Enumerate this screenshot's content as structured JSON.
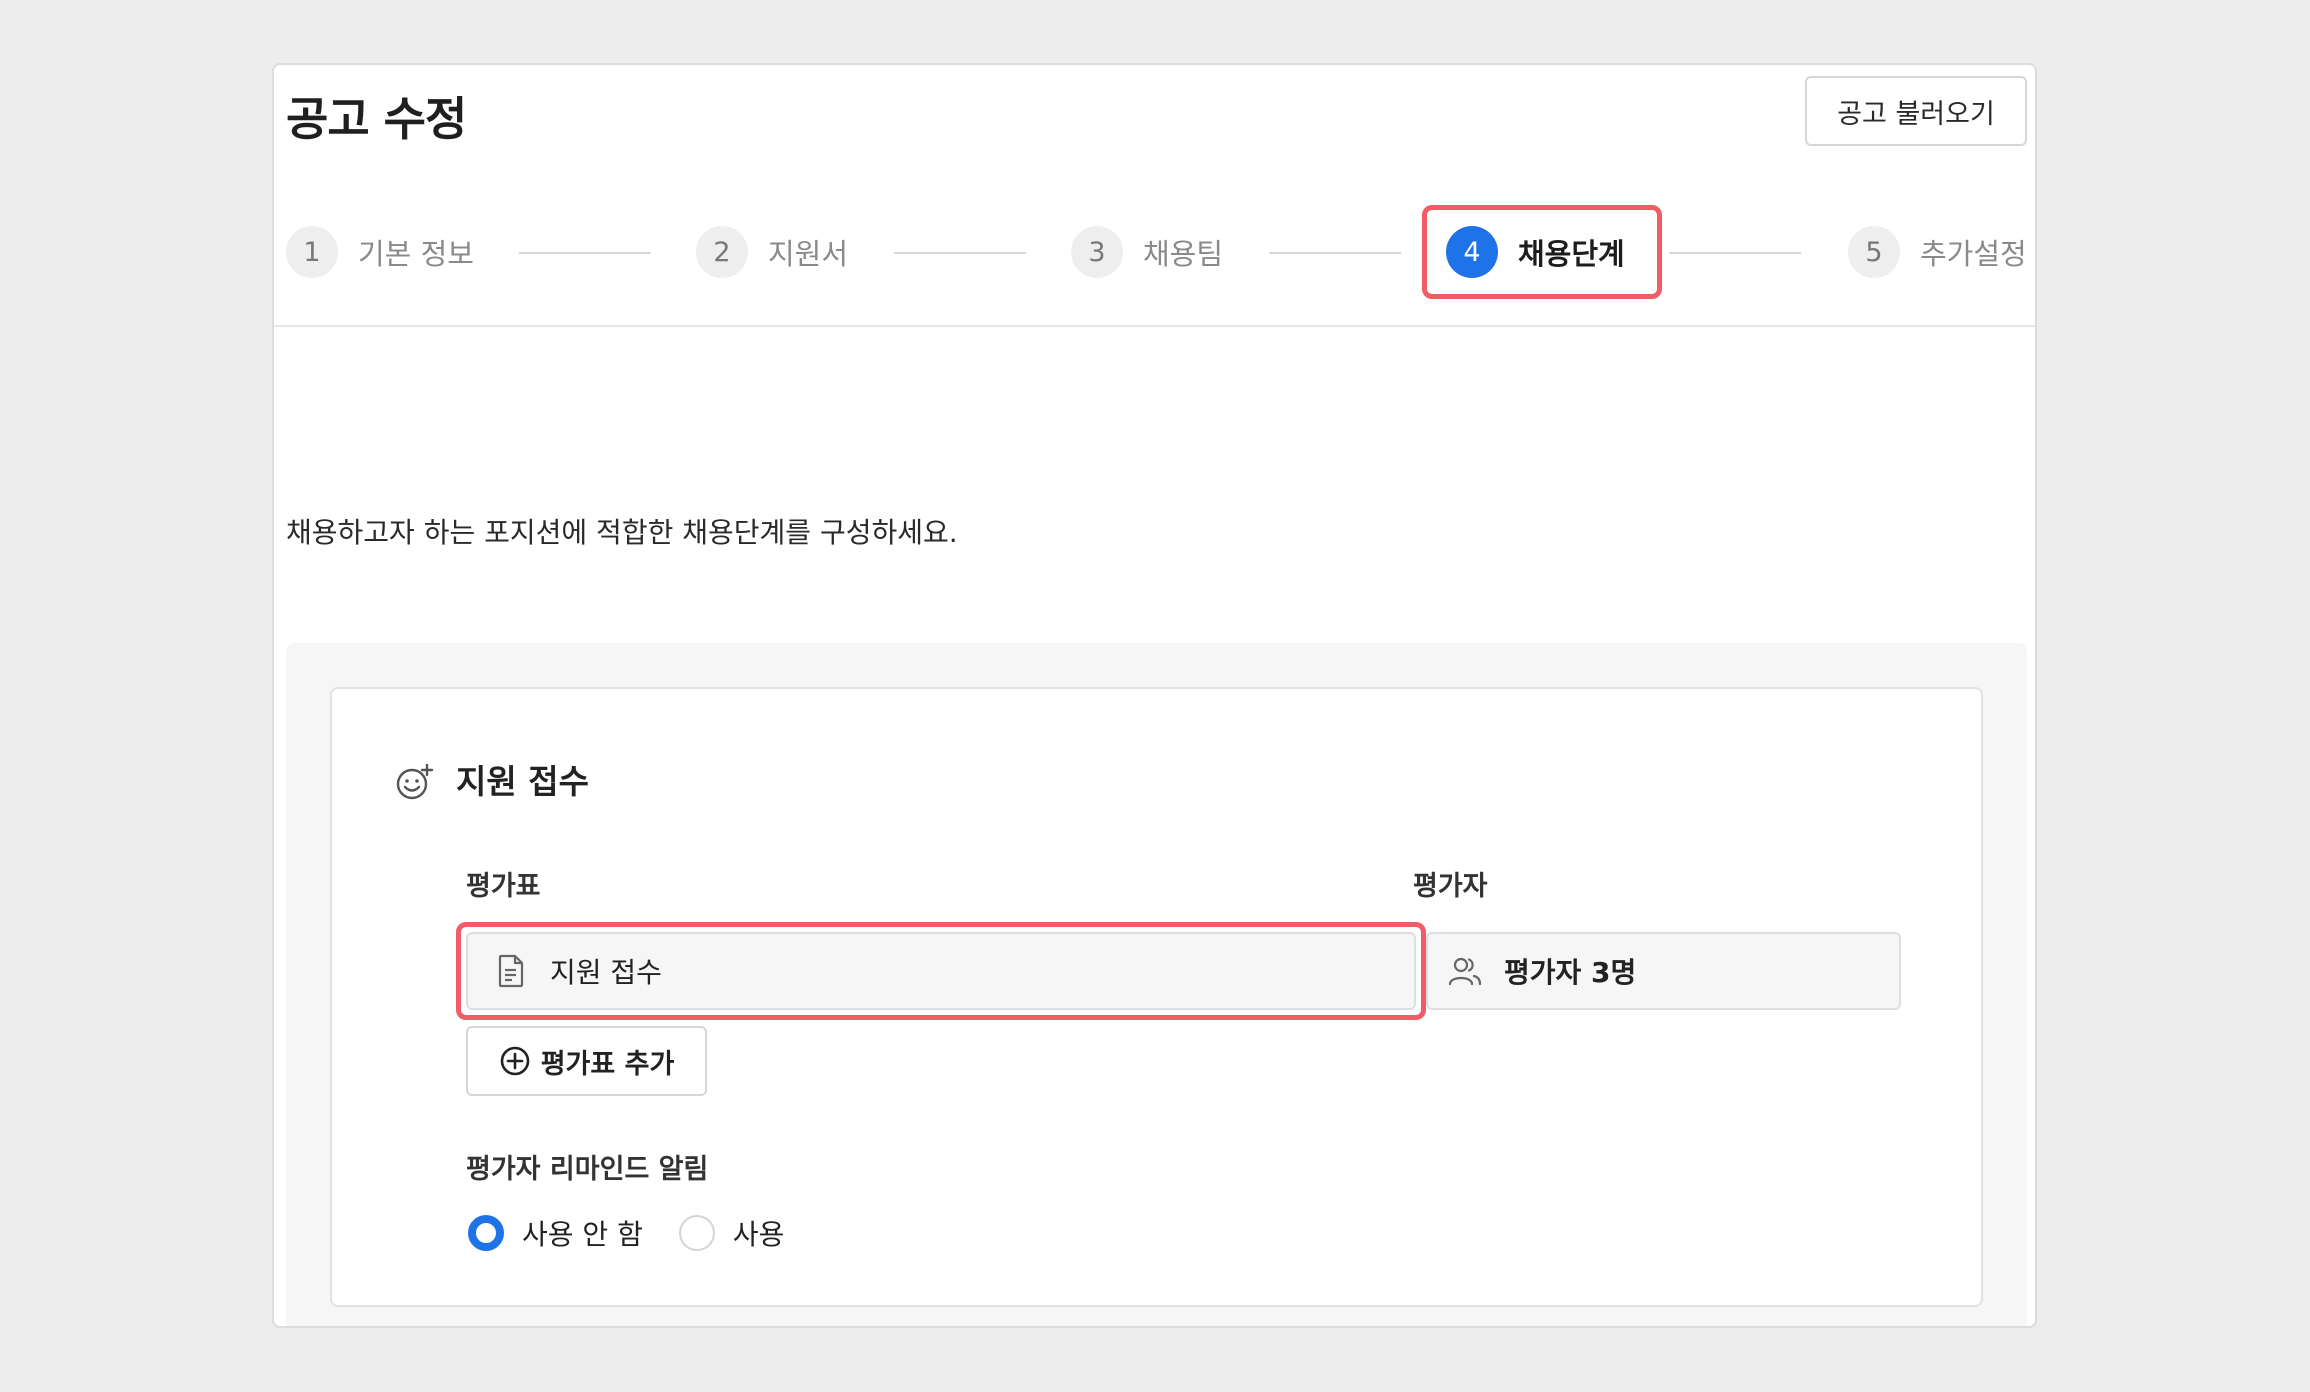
{
  "header": {
    "title": "공고 수정",
    "import_label": "공고 불러오기"
  },
  "steps": [
    {
      "num": "1",
      "label": "기본 정보"
    },
    {
      "num": "2",
      "label": "지원서"
    },
    {
      "num": "3",
      "label": "채용팀"
    },
    {
      "num": "4",
      "label": "채용단계"
    },
    {
      "num": "5",
      "label": "추가설정"
    }
  ],
  "active_step": 4,
  "description": "채용하고자 하는 포지션에 적합한 채용단계를 구성하세요.",
  "stage": {
    "title": "지원 접수",
    "sheet_label": "평가표",
    "sheet_value": "지원 접수",
    "evaluator_label": "평가자",
    "evaluator_value": "평가자 3명",
    "add_sheet_label": "평가표 추가",
    "remind_label": "평가자 리마인드 알림",
    "remind_options": [
      {
        "label": "사용 안 함",
        "checked": true
      },
      {
        "label": "사용",
        "checked": false
      }
    ]
  },
  "colors": {
    "accent": "#1f73e8",
    "highlight": "#f05d67"
  }
}
